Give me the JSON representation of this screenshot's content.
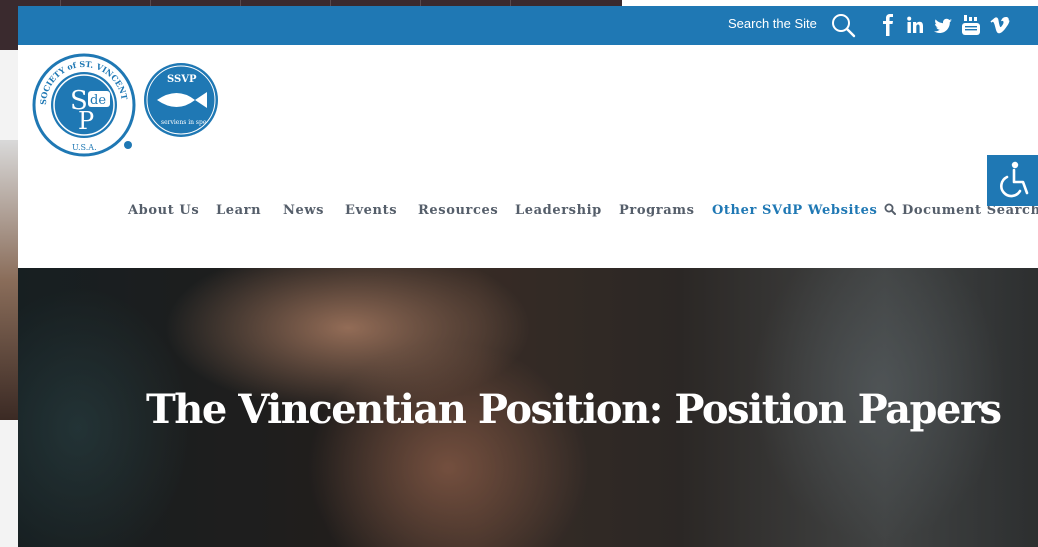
{
  "topbar": {
    "search_label": "Search the Site",
    "social_icons": [
      "facebook-icon",
      "linkedin-icon",
      "twitter-icon",
      "youtube-icon",
      "vimeo-icon"
    ]
  },
  "logos": {
    "svdp_text_top": "SOCIETY of ST. VINCENT de PAUL",
    "svdp_text_bottom": "U.S.A.",
    "svdp_monogram": "SVdP",
    "ssvp_text_top": "SSVP",
    "ssvp_text_bottom": "serviens in spe"
  },
  "nav": {
    "items": [
      "About Us",
      "Learn",
      "News",
      "Events",
      "Resources",
      "Leadership",
      "Programs",
      "Other SVdP Websites",
      "Document Search"
    ]
  },
  "hero": {
    "title": "The Vincentian Position: Position Papers"
  },
  "colors": {
    "brand_blue": "#1f78b4",
    "nav_text": "#555e6a"
  }
}
